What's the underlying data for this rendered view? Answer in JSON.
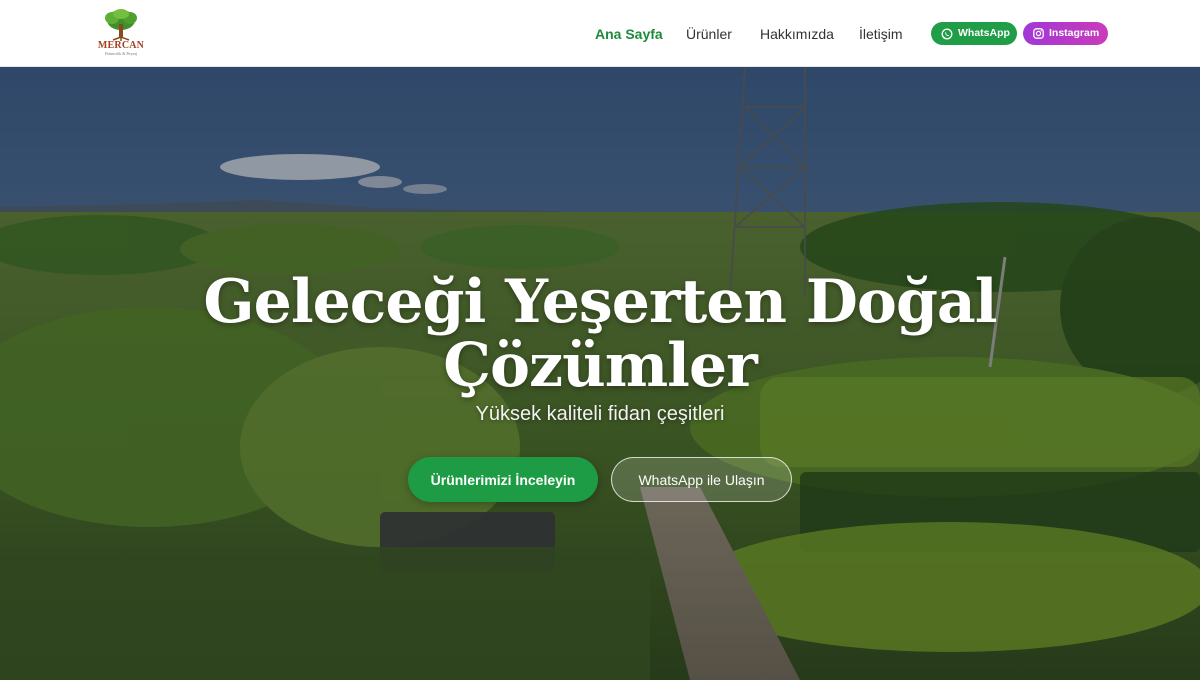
{
  "logo": {
    "name": "MERCAN",
    "tagline": "Fidancılık & Peyzaj"
  },
  "nav": {
    "items": [
      {
        "label": "Ana Sayfa",
        "active": true
      },
      {
        "label": "Ürünler",
        "active": false
      },
      {
        "label": "Hakkımızda",
        "active": false
      },
      {
        "label": "İletişim",
        "active": false
      }
    ],
    "whatsapp_label": "WhatsApp",
    "instagram_label": "Instagram"
  },
  "hero": {
    "title_line1": "Geleceği Yeşerten Doğal",
    "title_line2": "Çözümler",
    "subtitle": "Yüksek kaliteli fidan çeşitleri",
    "primary_button": "Ürünlerimizi İnceleyin",
    "secondary_button": "WhatsApp ile Ulaşın"
  },
  "colors": {
    "brand_green": "#1e9c45",
    "nav_active": "#1e8b3a",
    "instagram_start": "#a237d6",
    "instagram_end": "#c93cb9",
    "logo_text": "#a3401f"
  },
  "icons": {
    "logo": "tree-icon",
    "whatsapp": "whatsapp-icon",
    "instagram": "instagram-icon"
  }
}
